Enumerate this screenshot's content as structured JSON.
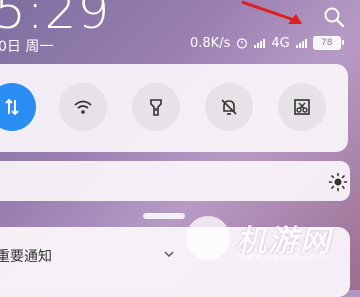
{
  "status_bar": {
    "time": "5:29",
    "date": "0日 周一",
    "network_speed": "0.8K/s",
    "network_type": "4G",
    "battery_level": "78"
  },
  "quick_toggles": [
    {
      "name": "data-toggle",
      "icon": "mobile-data-icon",
      "active": true
    },
    {
      "name": "wifi-toggle",
      "icon": "wifi-icon",
      "active": false
    },
    {
      "name": "flashlight-toggle",
      "icon": "flashlight-icon",
      "active": false
    },
    {
      "name": "silent-toggle",
      "icon": "bell-off-icon",
      "active": false
    },
    {
      "name": "screenshot-toggle",
      "icon": "screenshot-icon",
      "active": false
    }
  ],
  "brightness": {
    "icon": "sun-icon"
  },
  "notification_section": {
    "title": "重要通知"
  },
  "watermark": {
    "text": "机游网",
    "url": "www.jiyouw.com"
  },
  "colors": {
    "accent": "#2a8ef5",
    "arrow": "#e02020"
  }
}
